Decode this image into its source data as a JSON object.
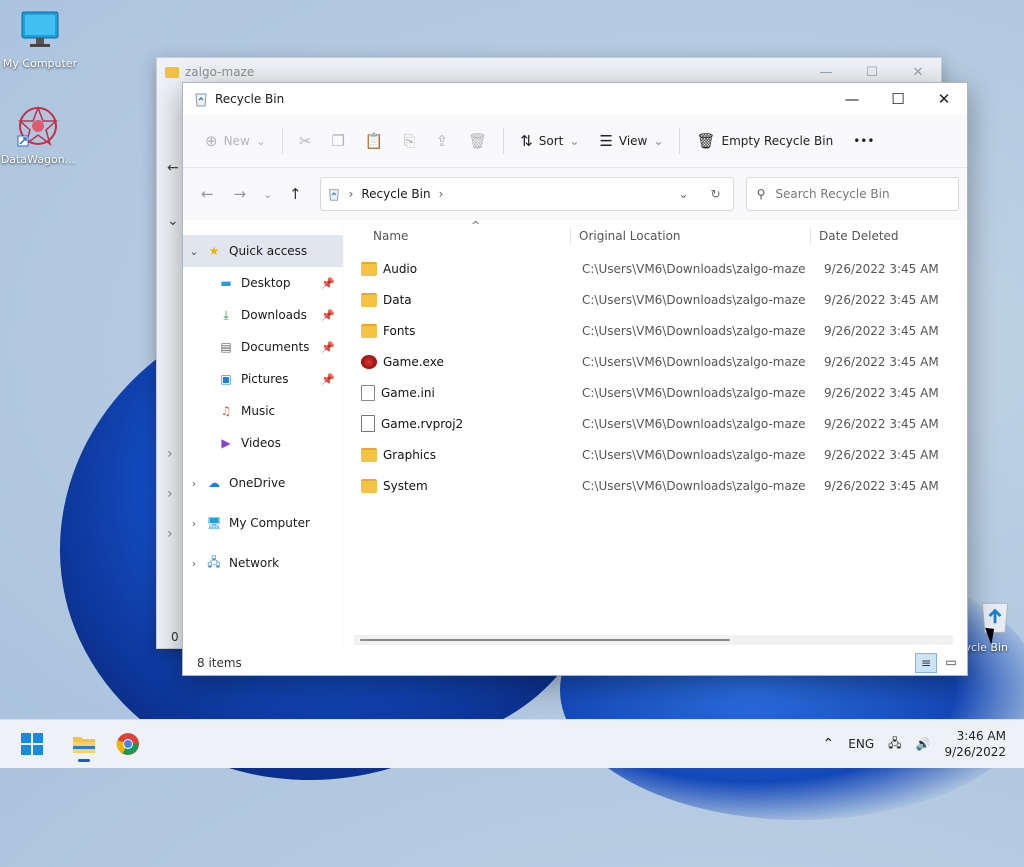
{
  "desktop": {
    "icons": [
      {
        "label": "My Computer"
      },
      {
        "label": "DataWagon..."
      },
      {
        "label": "cycle Bin"
      }
    ]
  },
  "back_window": {
    "title": "zalgo-maze",
    "status_fragment": "0 i"
  },
  "window": {
    "title": "Recycle Bin",
    "controls": {
      "minimize": "—",
      "maximize": "☐",
      "close": "✕"
    },
    "toolbar": {
      "new_label": "New",
      "sort_label": "Sort",
      "view_label": "View",
      "empty_label": "Empty Recycle Bin",
      "more_label": "•••"
    },
    "address": {
      "crumb": "Recycle Bin",
      "search_placeholder": "Search Recycle Bin"
    },
    "nav_pane": {
      "quick_access": "Quick access",
      "pinned": [
        {
          "label": "Desktop",
          "icon": "desktop-icon",
          "pinned": true
        },
        {
          "label": "Downloads",
          "icon": "download-icon",
          "pinned": true
        },
        {
          "label": "Documents",
          "icon": "document-icon",
          "pinned": true
        },
        {
          "label": "Pictures",
          "icon": "pictures-icon",
          "pinned": true
        },
        {
          "label": "Music",
          "icon": "music-icon",
          "pinned": false
        },
        {
          "label": "Videos",
          "icon": "videos-icon",
          "pinned": false
        }
      ],
      "roots": [
        {
          "label": "OneDrive",
          "icon": "cloud-icon"
        },
        {
          "label": "My Computer",
          "icon": "computer-icon"
        },
        {
          "label": "Network",
          "icon": "network-icon"
        }
      ]
    },
    "columns": {
      "name": "Name",
      "location": "Original Location",
      "date": "Date Deleted"
    },
    "files": [
      {
        "name": "Audio",
        "type": "folder",
        "location": "C:\\Users\\VM6\\Downloads\\zalgo-maze",
        "date": "9/26/2022 3:45 AM"
      },
      {
        "name": "Data",
        "type": "folder",
        "location": "C:\\Users\\VM6\\Downloads\\zalgo-maze",
        "date": "9/26/2022 3:45 AM"
      },
      {
        "name": "Fonts",
        "type": "folder",
        "location": "C:\\Users\\VM6\\Downloads\\zalgo-maze",
        "date": "9/26/2022 3:45 AM"
      },
      {
        "name": "Game.exe",
        "type": "exe",
        "location": "C:\\Users\\VM6\\Downloads\\zalgo-maze",
        "date": "9/26/2022 3:45 AM"
      },
      {
        "name": "Game.ini",
        "type": "ini",
        "location": "C:\\Users\\VM6\\Downloads\\zalgo-maze",
        "date": "9/26/2022 3:45 AM"
      },
      {
        "name": "Game.rvproj2",
        "type": "file",
        "location": "C:\\Users\\VM6\\Downloads\\zalgo-maze",
        "date": "9/26/2022 3:45 AM"
      },
      {
        "name": "Graphics",
        "type": "folder",
        "location": "C:\\Users\\VM6\\Downloads\\zalgo-maze",
        "date": "9/26/2022 3:45 AM"
      },
      {
        "name": "System",
        "type": "folder",
        "location": "C:\\Users\\VM6\\Downloads\\zalgo-maze",
        "date": "9/26/2022 3:45 AM"
      }
    ],
    "status_text": "8 items"
  },
  "taskbar": {
    "lang": "ENG",
    "time": "3:46 AM",
    "date": "9/26/2022"
  }
}
